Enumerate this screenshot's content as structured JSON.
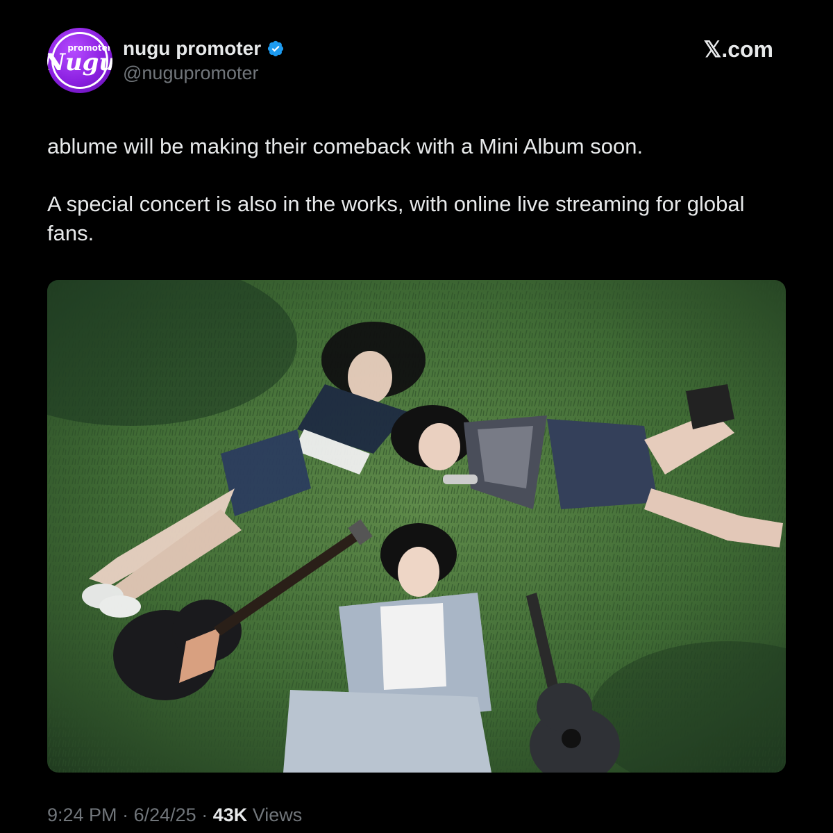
{
  "account": {
    "avatar_label_top": "promoter",
    "avatar_label_main": "Nugu",
    "display_name": "nugu promoter",
    "handle": "@nugupromoter",
    "verified": true
  },
  "site_logo": "𝕏.com",
  "tweet": {
    "paragraphs": [
      "ablume will be making their comeback with a Mini Album soon.",
      "A special concert is also in the works, with online live streaming for global fans."
    ]
  },
  "media": {
    "description_icon": "photo-three-people-lying-on-grass-with-guitars"
  },
  "footer": {
    "time": "9:24 PM",
    "separator": "·",
    "date": "6/24/25",
    "views_count": "43K",
    "views_label": "Views"
  },
  "colors": {
    "background": "#000000",
    "text_primary": "#e7e9ea",
    "text_secondary": "#71767b",
    "verified_blue": "#1d9bf0",
    "avatar_purple": "#8a1fe0"
  }
}
